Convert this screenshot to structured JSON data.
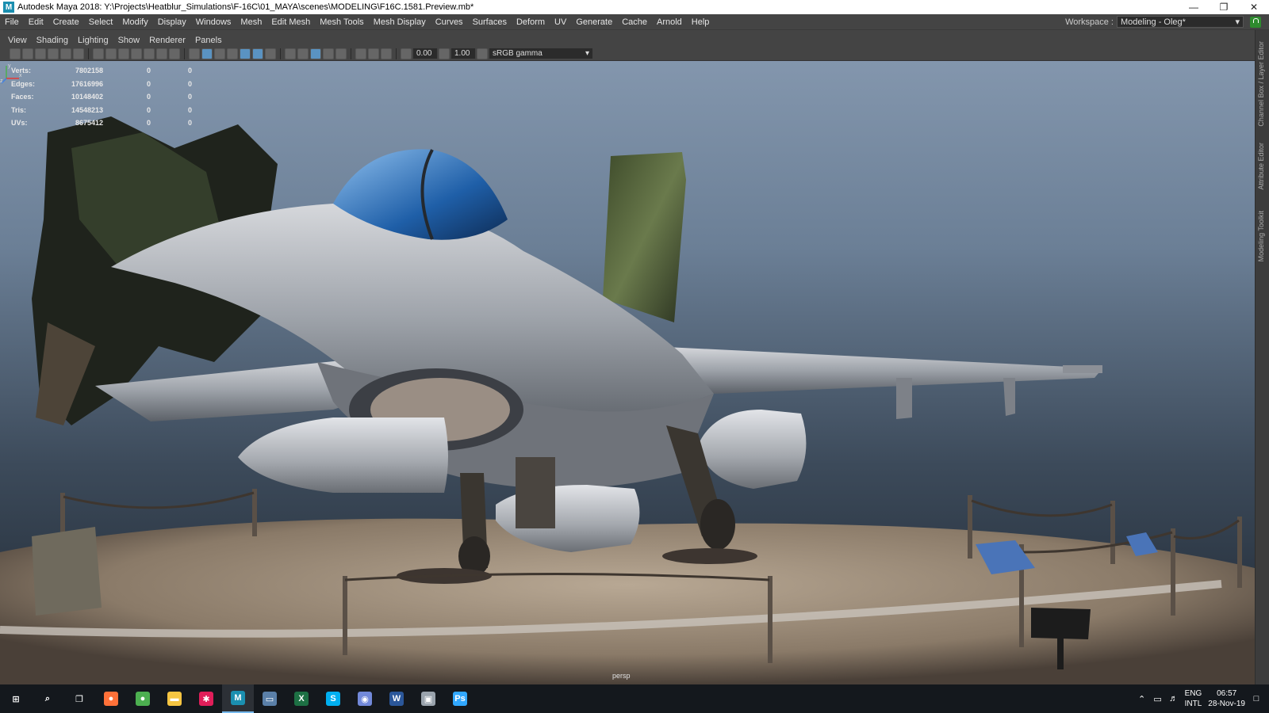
{
  "window": {
    "title": "Autodesk Maya 2018: Y:\\Projects\\Heatblur_Simulations\\F-16C\\01_MAYA\\scenes\\MODELING\\F16C.1581.Preview.mb*",
    "app_icon_letter": "M",
    "controls": [
      "minimize-icon",
      "restore-icon",
      "close-icon"
    ]
  },
  "menubar": {
    "items": [
      "File",
      "Edit",
      "Create",
      "Select",
      "Modify",
      "Display",
      "Windows",
      "Mesh",
      "Edit Mesh",
      "Mesh Tools",
      "Mesh Display",
      "Curves",
      "Surfaces",
      "Deform",
      "UV",
      "Generate",
      "Cache",
      "Arnold",
      "Help"
    ],
    "workspace_label": "Workspace :",
    "workspace_value": "Modeling - Oleg*"
  },
  "panel_menu": {
    "items": [
      "View",
      "Shading",
      "Lighting",
      "Show",
      "Renderer",
      "Panels"
    ]
  },
  "viewport_toolbar": {
    "exposure": "0.00",
    "gamma": "1.00",
    "color_space": "sRGB gamma"
  },
  "right_dock": {
    "tabs": [
      "Channel Box / Layer Editor",
      "Attribute Editor",
      "Modeling Toolkit"
    ]
  },
  "hud": {
    "rows": [
      {
        "label": "Verts:",
        "value": "7802158",
        "sel": "0",
        "comp": "0"
      },
      {
        "label": "Edges:",
        "value": "17616996",
        "sel": "0",
        "comp": "0"
      },
      {
        "label": "Faces:",
        "value": "10148402",
        "sel": "0",
        "comp": "0"
      },
      {
        "label": "Tris:",
        "value": "14548213",
        "sel": "0",
        "comp": "0"
      },
      {
        "label": "UVs:",
        "value": "8675412",
        "sel": "0",
        "comp": "0"
      }
    ]
  },
  "viewport": {
    "camera": "persp",
    "axis_labels": {
      "y": "y",
      "x": "x",
      "z": "z"
    }
  },
  "taskbar": {
    "apps": [
      {
        "name": "start-icon",
        "glyph": "⊞",
        "color": "#ffffff"
      },
      {
        "name": "search-icon",
        "glyph": "⌕",
        "color": "#ffffff"
      },
      {
        "name": "task-view-icon",
        "glyph": "❐",
        "color": "#ffffff"
      },
      {
        "name": "firefox-icon",
        "glyph": "●",
        "color": "#ff7139"
      },
      {
        "name": "chrome-icon",
        "glyph": "●",
        "color": "#4caf50"
      },
      {
        "name": "file-explorer-icon",
        "glyph": "▬",
        "color": "#f5c542"
      },
      {
        "name": "slack-icon",
        "glyph": "✱",
        "color": "#e01e5a"
      },
      {
        "name": "maya-icon",
        "glyph": "M",
        "color": "#1b8fb0"
      },
      {
        "name": "window-app-icon",
        "glyph": "▭",
        "color": "#5a7fa8"
      },
      {
        "name": "excel-icon",
        "glyph": "X",
        "color": "#1d7044"
      },
      {
        "name": "skype-icon",
        "glyph": "S",
        "color": "#00aff0"
      },
      {
        "name": "discord-icon",
        "glyph": "◉",
        "color": "#7289da"
      },
      {
        "name": "word-icon",
        "glyph": "W",
        "color": "#2b579a"
      },
      {
        "name": "app-icon",
        "glyph": "▣",
        "color": "#9aa3ad"
      },
      {
        "name": "photoshop-icon",
        "glyph": "Ps",
        "color": "#31a8ff"
      }
    ],
    "active_app": "maya-icon",
    "language": "ENG",
    "layout": "INTL",
    "time": "06:57",
    "date": "28-Nov-19"
  }
}
